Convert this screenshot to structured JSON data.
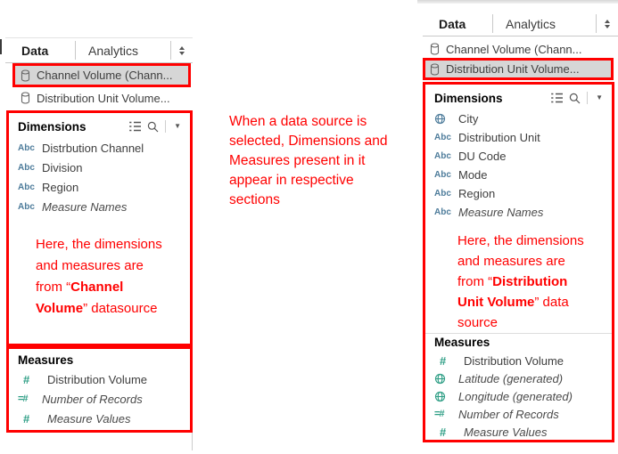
{
  "icons": {
    "abc": "Abc",
    "hash": "#",
    "equals_hash": "=#",
    "caret": "▼"
  },
  "colors": {
    "annotation_red": "#ff0000",
    "dimension_blue": "#4e7c9b",
    "measure_green": "#2e9e85",
    "selected_row_bg": "#d6d6d6"
  },
  "left_panel": {
    "tabs": {
      "data": "Data",
      "analytics": "Analytics"
    },
    "data_sources": [
      {
        "label": "Channel Volume (Chann...",
        "selected": true
      },
      {
        "label": "Distribution Unit Volume...",
        "selected": false
      }
    ],
    "dimensions": {
      "header": "Dimensions",
      "items": [
        {
          "icon": "abc-icon",
          "label": "Distrbution Channel"
        },
        {
          "icon": "abc-icon",
          "label": "Division"
        },
        {
          "icon": "abc-icon",
          "label": "Region"
        },
        {
          "icon": "abc-icon",
          "label": "Measure Names",
          "italic": true
        }
      ]
    },
    "annotation": {
      "line1": "Here, the dimensions",
      "line2": "and measures are",
      "line3_pre": "from “",
      "line3_bold": "Channel",
      "line4_bold": "Volume",
      "line4_post": "” datasource"
    },
    "measures": {
      "header": "Measures",
      "items": [
        {
          "icon": "hash-icon",
          "label": "Distribution Volume"
        },
        {
          "icon": "equals-hash-icon",
          "label": "Number of Records",
          "italic": true
        },
        {
          "icon": "hash-icon",
          "label": "Measure Values",
          "italic": true
        }
      ]
    }
  },
  "center_annotation": {
    "line1": "When a data source is",
    "line2": "selected, Dimensions and",
    "line3": "Measures present in it",
    "line4": "appear in respective",
    "line5": "sections"
  },
  "right_panel": {
    "tabs": {
      "data": "Data",
      "analytics": "Analytics"
    },
    "data_sources": [
      {
        "label": "Channel Volume (Chann...",
        "selected": false
      },
      {
        "label": "Distribution Unit Volume...",
        "selected": true
      }
    ],
    "dimensions": {
      "header": "Dimensions",
      "items": [
        {
          "icon": "globe-icon",
          "label": "City"
        },
        {
          "icon": "abc-icon",
          "label": "Distribution Unit"
        },
        {
          "icon": "abc-icon",
          "label": "DU Code"
        },
        {
          "icon": "abc-icon",
          "label": "Mode"
        },
        {
          "icon": "abc-icon",
          "label": "Region"
        },
        {
          "icon": "abc-icon",
          "label": "Measure Names",
          "italic": true
        }
      ]
    },
    "annotation": {
      "line1": "Here, the dimensions",
      "line2": "and measures are",
      "line3_pre": "from “",
      "line3_bold": "Distribution",
      "line4_bold": "Unit Volume",
      "line4_post": "” data",
      "line5": "source"
    },
    "measures": {
      "header": "Measures",
      "items": [
        {
          "icon": "hash-icon",
          "label": "Distribution Volume"
        },
        {
          "icon": "globe-icon",
          "label": "Latitude (generated)",
          "italic": true
        },
        {
          "icon": "globe-icon",
          "label": "Longitude (generated)",
          "italic": true
        },
        {
          "icon": "equals-hash-icon",
          "label": "Number of Records",
          "italic": true
        },
        {
          "icon": "hash-icon",
          "label": "Measure Values",
          "italic": true
        }
      ]
    }
  }
}
